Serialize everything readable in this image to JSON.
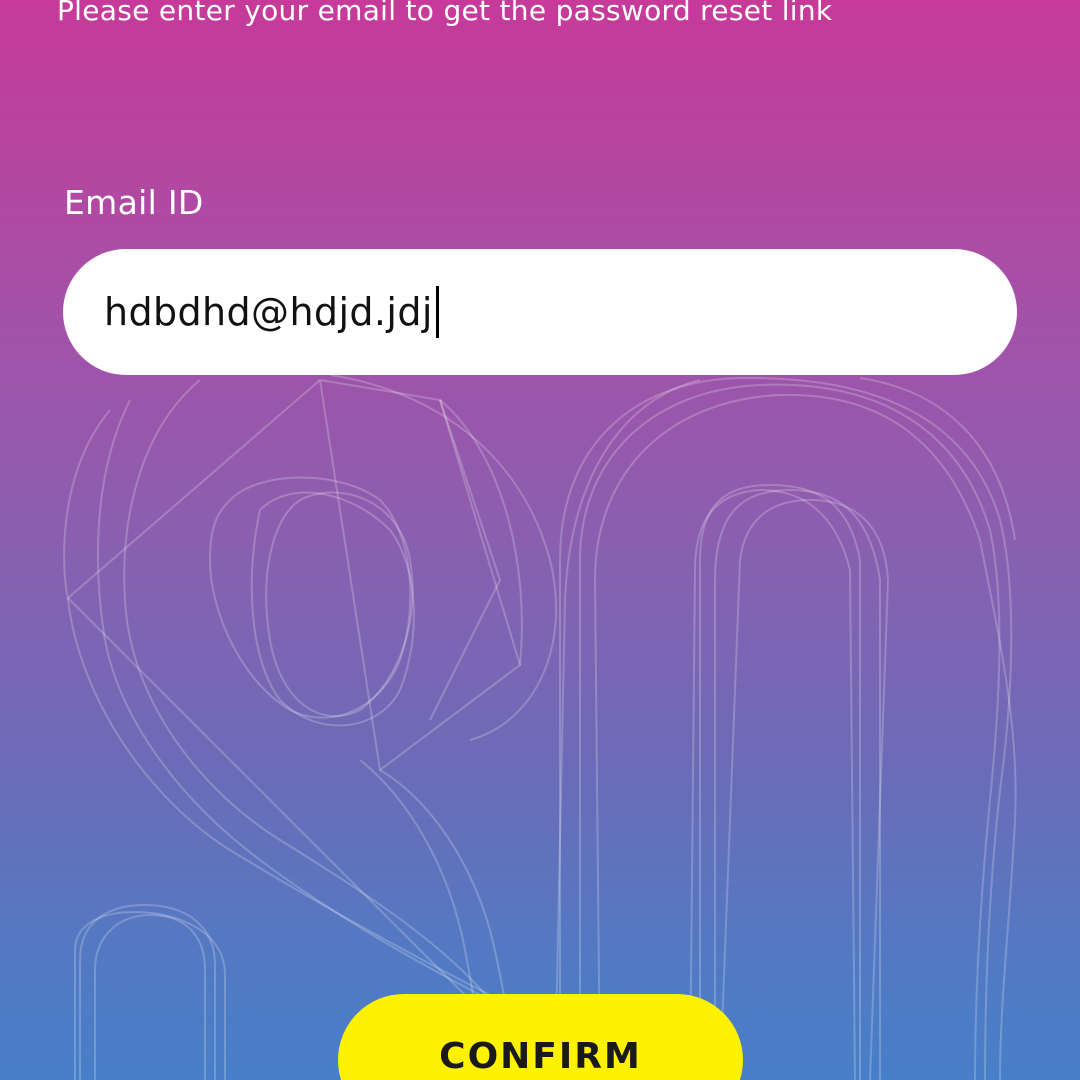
{
  "instruction_text": "Please enter your email to get the password reset link",
  "email_field": {
    "label": "Email ID",
    "value": "hdbdhd@hdjd.jdj"
  },
  "confirm_button": {
    "label": "CONFIRM"
  },
  "colors": {
    "gradient_top": "#c73a9a",
    "gradient_bottom": "#477fc8",
    "button_yellow": "#fff200",
    "field_white": "#ffffff"
  },
  "icons": {
    "background_artwork": "outline-letters-decoration"
  }
}
